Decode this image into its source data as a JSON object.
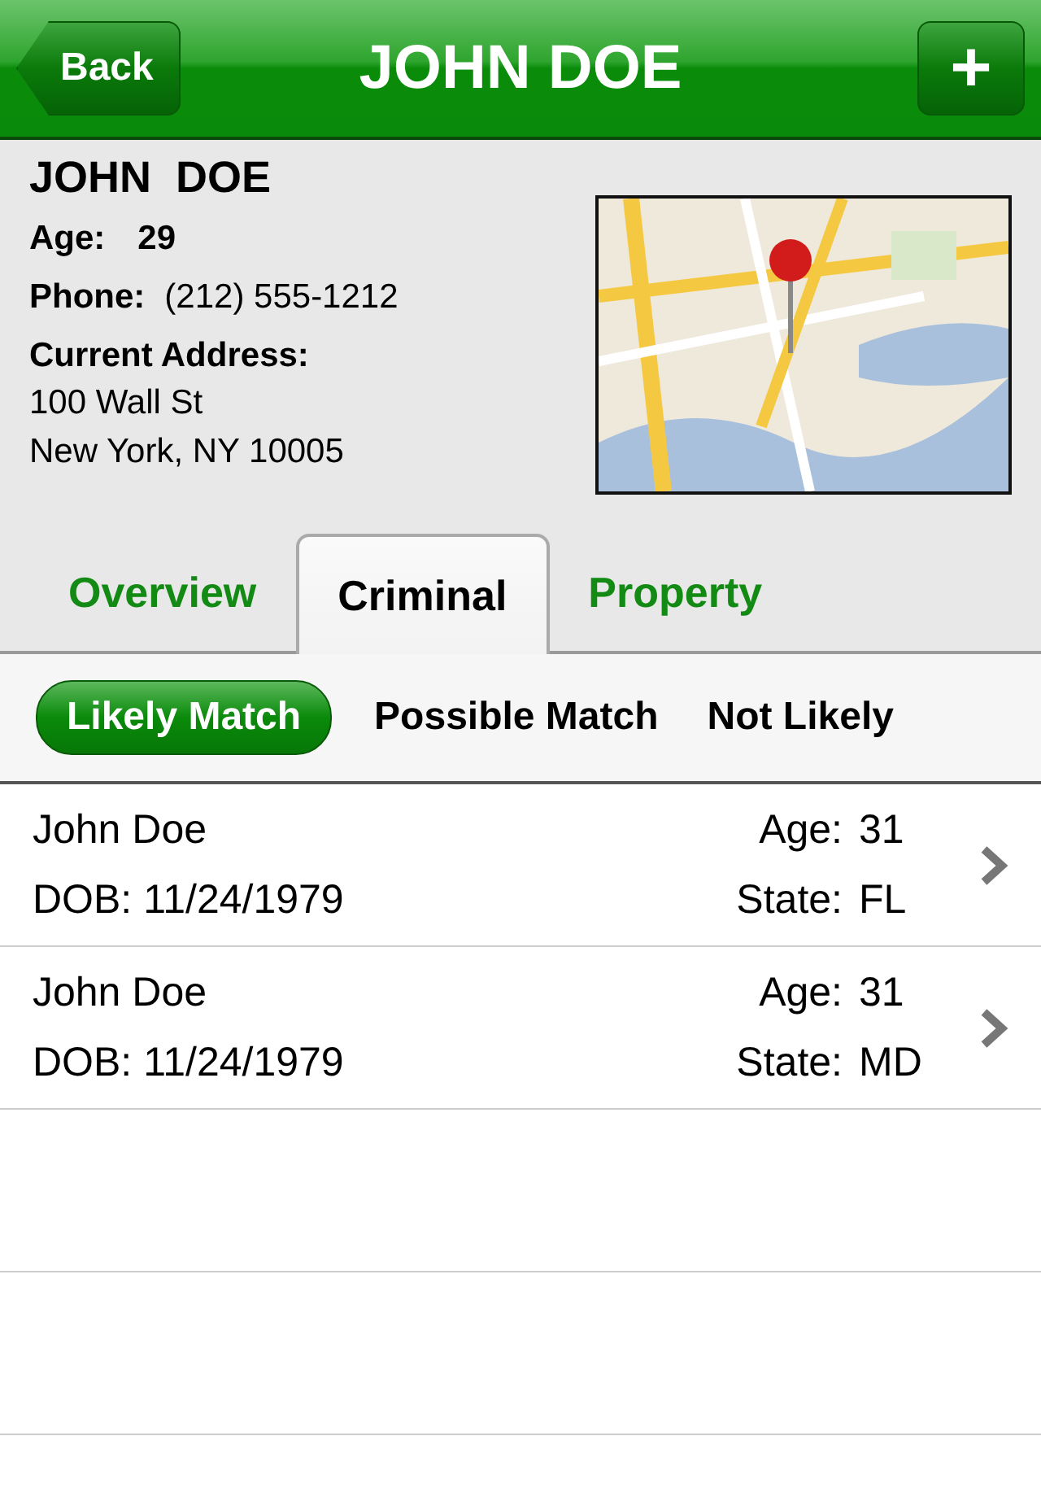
{
  "nav_bar": {
    "back": "Back",
    "title": "JOHN DOE",
    "add": "+"
  },
  "person": {
    "name": "JOHN  DOE",
    "age_label": "Age:",
    "age": "29",
    "phone_label": "Phone:",
    "phone": "(212) 555-1212",
    "address_label": "Current Address:",
    "address_lines": [
      "100 Wall St",
      "New York, NY 10005"
    ],
    "map": {
      "kind": "picture"
    }
  },
  "tabs": [
    {
      "label": "Overview",
      "selected": false
    },
    {
      "label": "Criminal",
      "selected": true
    },
    {
      "label": "Property",
      "selected": false
    }
  ],
  "filters": [
    {
      "label": "Likely Match",
      "selected": true
    },
    {
      "label": "Possible Match",
      "selected": false
    },
    {
      "label": "Not Likely",
      "selected": false
    }
  ],
  "results": [
    {
      "name": "John Doe",
      "dob": "DOB: 11/24/1979",
      "age_label": "Age:",
      "age": "31",
      "state_label": "State:",
      "state": "FL"
    },
    {
      "name": "John Doe",
      "dob": "DOB: 11/24/1979",
      "age_label": "Age:",
      "age": "31",
      "state_label": "State:",
      "state": "MD"
    }
  ]
}
